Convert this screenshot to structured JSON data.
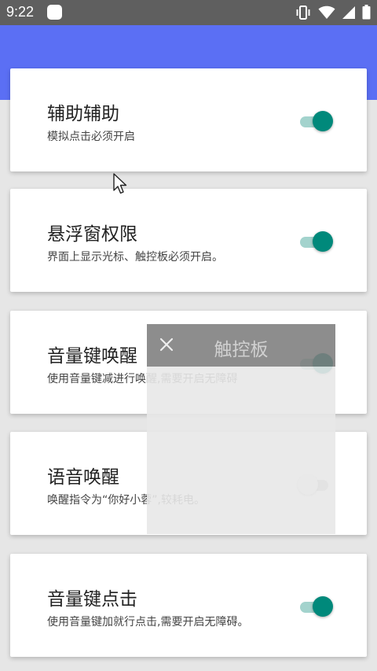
{
  "status_bar": {
    "time": "9:22",
    "icons": [
      "vibrate-icon",
      "wifi-icon",
      "signal-icon",
      "battery-icon"
    ]
  },
  "header": {
    "color": "#5b6ff4"
  },
  "settings": [
    {
      "title": "辅助辅助",
      "subtitle": "模拟点击必须开启",
      "enabled": true
    },
    {
      "title": "悬浮窗权限",
      "subtitle": "界面上显示光标、触控板必须开启。",
      "enabled": true
    },
    {
      "title": "音量键唤醒",
      "subtitle": "使用音量键减进行唤醒,需要开启无障碍",
      "enabled": true
    },
    {
      "title": "语音唤醒",
      "subtitle": "唤醒指令为“你好小蓉”,较耗电。",
      "enabled": false
    },
    {
      "title": "音量键点击",
      "subtitle": "使用音量键加就行点击,需要开启无障碍。",
      "enabled": true
    }
  ],
  "touchpad": {
    "title": "触控板",
    "close_icon": "close-icon"
  },
  "colors": {
    "toggle_on": "#00897b",
    "toggle_track_on": "#a3d3cd",
    "accent": "#5b6ff4"
  }
}
